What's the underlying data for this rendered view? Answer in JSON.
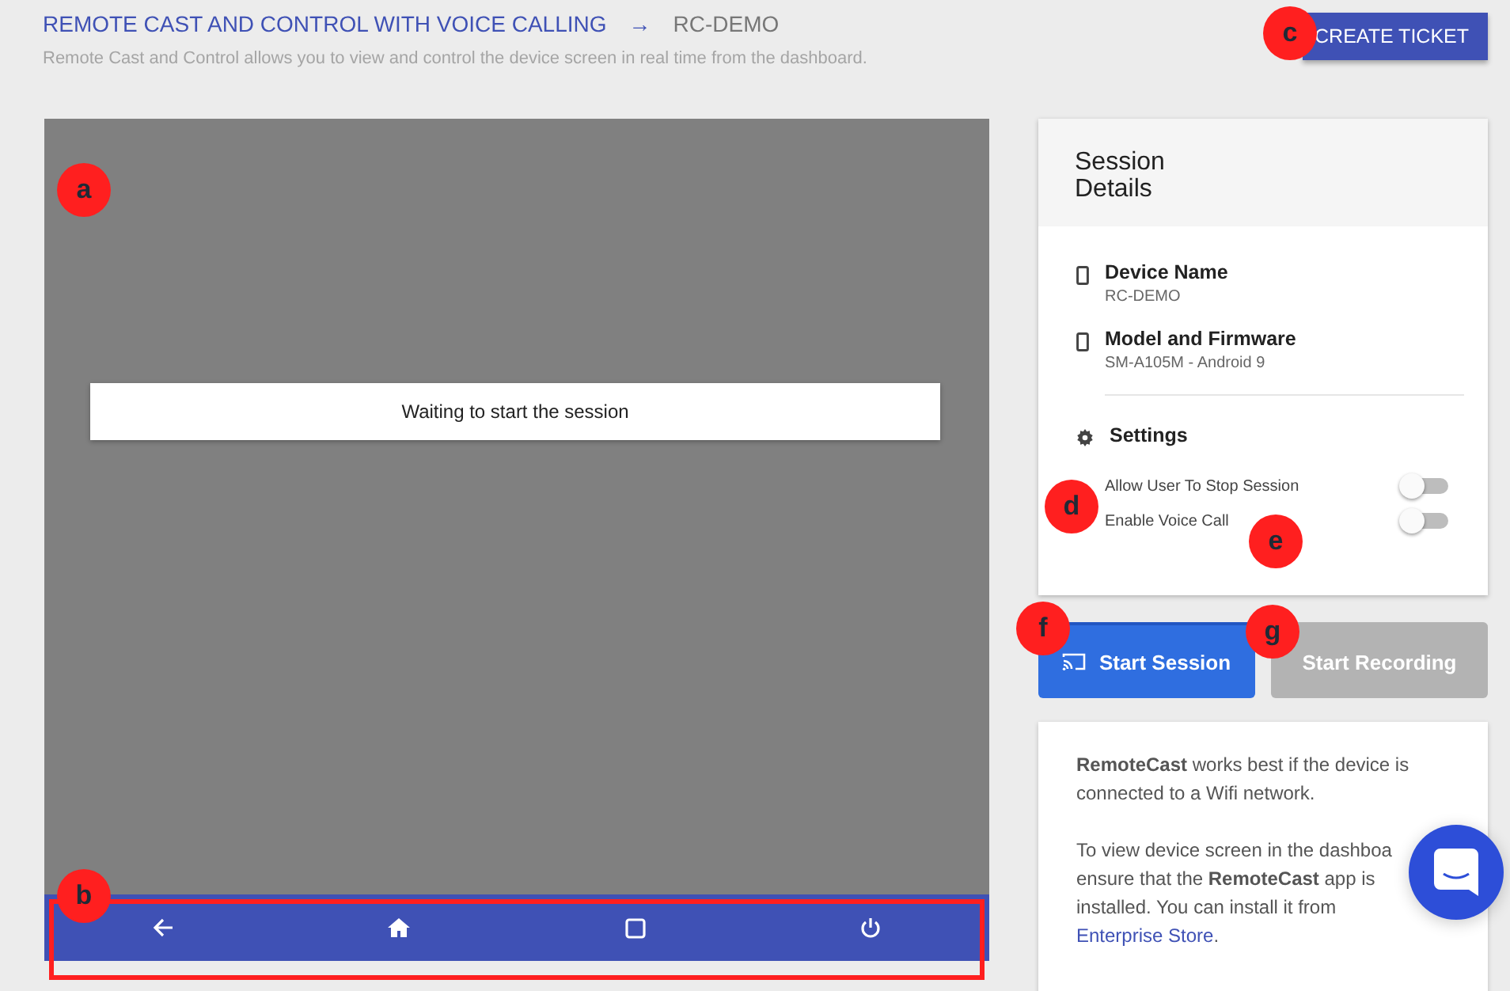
{
  "breadcrumb": {
    "title": "REMOTE CAST AND CONTROL WITH VOICE CALLING",
    "arrow": "→",
    "current": "RC-DEMO"
  },
  "description": "Remote Cast and Control allows you to view and control the device screen in real time from the dashboard.",
  "create_ticket": "CREATE TICKET",
  "device_screen": {
    "message": "Waiting to start the session"
  },
  "session_details": {
    "title_lines": [
      "Session",
      "Details"
    ],
    "items": [
      {
        "label": "Device Name",
        "value": "RC-DEMO"
      },
      {
        "label": "Model and Firmware",
        "value": "SM-A105M - Android 9"
      }
    ],
    "settings_title": "Settings",
    "settings": [
      {
        "label": "Allow User To Stop Session",
        "on": false
      },
      {
        "label": "Enable Voice Call",
        "on": false
      }
    ]
  },
  "actions": [
    {
      "label": "Start Session",
      "disabled": false
    },
    {
      "label": "Start Recording",
      "disabled": true
    }
  ],
  "info": {
    "paragraph_1": "**RemoteCast** works best if the device is connected to a Wifi network.",
    "paragraph_2": "To view device screen in the dashboa ensure that the **RemoteCast** app is installed. You can install it from",
    "link": "Enterprise Store",
    "after_link": "."
  },
  "callouts": [
    {
      "label": "a"
    },
    {
      "label": "b"
    },
    {
      "label": "c"
    },
    {
      "label": "d"
    },
    {
      "label": "e"
    },
    {
      "label": "f"
    },
    {
      "label": "g"
    }
  ]
}
